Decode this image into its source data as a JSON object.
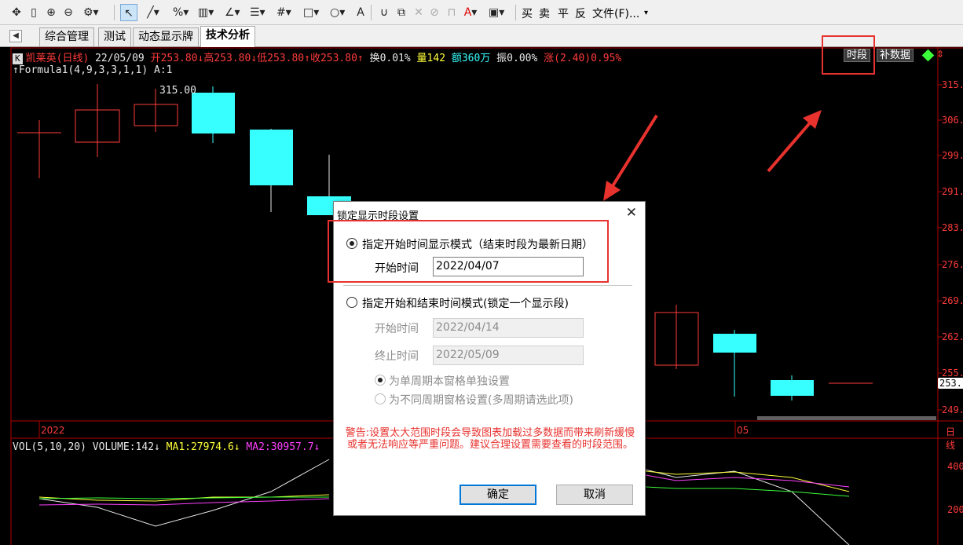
{
  "toolbar": {
    "file_menu": "文件(F)...",
    "trade_buy": "买",
    "trade_sell": "卖",
    "trade_flat": "平",
    "trade_reverse": "反",
    "icons": [
      "move-icon",
      "ruler-icon",
      "zoom-in-icon",
      "zoom-out-icon",
      "settings-icon",
      "cursor-icon",
      "line-icon",
      "percent-icon",
      "grid-icon",
      "angle-icon",
      "level-icon",
      "hash-icon",
      "rect-icon",
      "circle-icon",
      "text-icon",
      "magnet-icon",
      "copy-icon",
      "delete-icon",
      "lock-icon",
      "color-icon",
      "save-icon"
    ],
    "text_tool": "A"
  },
  "tabs": {
    "items": [
      {
        "label": "综合管理",
        "active": false
      },
      {
        "label": "测试",
        "active": false
      },
      {
        "label": "动态显示牌",
        "active": false
      },
      {
        "label": "技术分析",
        "active": true
      }
    ]
  },
  "chart": {
    "k_badge": "K",
    "stock_name": "凯莱英(日线)",
    "date": "22/05/09",
    "open": "开253.80↓",
    "high": "高253.80↓",
    "low": "低253.80↑",
    "close": "收253.80↑",
    "turnover": "换0.01%",
    "volume": "量142",
    "amount": "额360万",
    "amplitude": "振0.00%",
    "change": "涨(2.40)0.95%",
    "period_button": "时段",
    "fill_data_button": "补数据",
    "formula": "↑Formula1(4,9,3,3,1,1) A:1",
    "high_marker": "315.00",
    "price_axis": [
      "315.",
      "306.",
      "299.",
      "291.",
      "283.",
      "276.",
      "269.",
      "262.",
      "255.",
      "249."
    ],
    "current_price": "253.",
    "date_labels": [
      "2022",
      "05",
      "日线"
    ],
    "vol_label": "VOL(5,10,20)",
    "vol_value": "VOLUME:142↓",
    "ma1": "MA1:27974.6↓",
    "ma2": "MA2:30957.7↓",
    "vol_axis": [
      "400",
      "200"
    ],
    "colors": {
      "up": "#ff3b3b",
      "down": "#37ffff",
      "background": "#000000"
    }
  },
  "dialog": {
    "title": "锁定显示时段设置",
    "close_icon": "close-icon",
    "mode1_label": "指定开始时间显示模式（结束时段为最新日期）",
    "mode1_start_label": "开始时间",
    "mode1_start_value": "2022/04/07",
    "mode2_label": "指定开始和结束时间模式(锁定一个显示段)",
    "mode2_start_label": "开始时间",
    "mode2_start_value": "2022/04/14",
    "mode2_end_label": "终止时间",
    "mode2_end_value": "2022/05/09",
    "sub1_label": "为单周期本窗格单独设置",
    "sub2_label": "为不同周期窗格设置(多周期请选此项)",
    "warning": "警告:设置太大范围时段会导致图表加载过多数据而带来刷新缓慢或者无法响应等严重问题。建议合理设置需要查看的时段范围。",
    "ok": "确定",
    "cancel": "取消"
  }
}
